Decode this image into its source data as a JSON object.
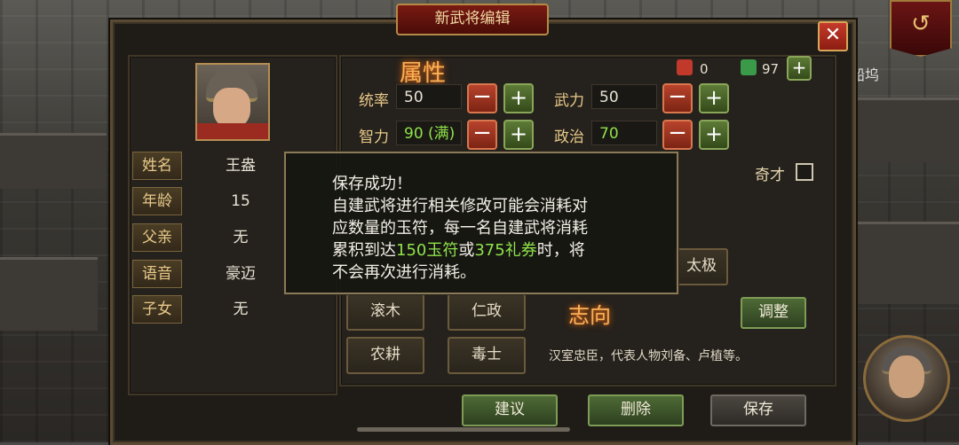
{
  "dialog": {
    "title": "新武将编辑",
    "close_symbol": "✕"
  },
  "background": {
    "side_label": "船坞",
    "ribbon_symbol": "↺"
  },
  "profile": {
    "fields": [
      {
        "label": "姓名",
        "value": "王盎"
      },
      {
        "label": "年龄",
        "value": "15"
      },
      {
        "label": "父亲",
        "value": "无"
      },
      {
        "label": "语音",
        "value": "豪迈"
      },
      {
        "label": "子女",
        "value": "无"
      }
    ]
  },
  "resources": {
    "jade": {
      "icon": "jade-token-icon",
      "value": "0",
      "color": "#c0392b"
    },
    "coupon": {
      "icon": "coupon-icon",
      "value": "97",
      "color": "#3a9a4a"
    }
  },
  "attributes": {
    "title": "属性",
    "stats": [
      {
        "label": "统率",
        "value": "50",
        "color": "#e8e2d4"
      },
      {
        "label": "武力",
        "value": "50",
        "color": "#e8e2d4"
      },
      {
        "label": "智力",
        "value": "90 (满)",
        "color": "#8ee24a"
      },
      {
        "label": "政治",
        "value": "70",
        "color": "#8ee24a"
      }
    ],
    "genius_label": "奇才",
    "genius_checked": false
  },
  "skills": {
    "items": [
      "滚木",
      "仁政",
      "农耕",
      "毒士"
    ],
    "partial_item": "太极"
  },
  "ambition": {
    "title": "志向",
    "adjust_label": "调整",
    "description": "汉室忠臣，代表人物刘备、卢植等。"
  },
  "actions": {
    "suggest": "建议",
    "delete": "删除",
    "save": "保存"
  },
  "toast": {
    "line1": "保存成功！",
    "line2": "自建武将进行相关修改可能会消耗对",
    "line3": "应数量的玉符，每一名自建武将消耗",
    "line4_a": "累积到达",
    "line4_hl1": "150玉符",
    "line4_b": "或",
    "line4_hl2": "375礼券",
    "line4_c": "时，将",
    "line5": "不会再次进行消耗。"
  }
}
